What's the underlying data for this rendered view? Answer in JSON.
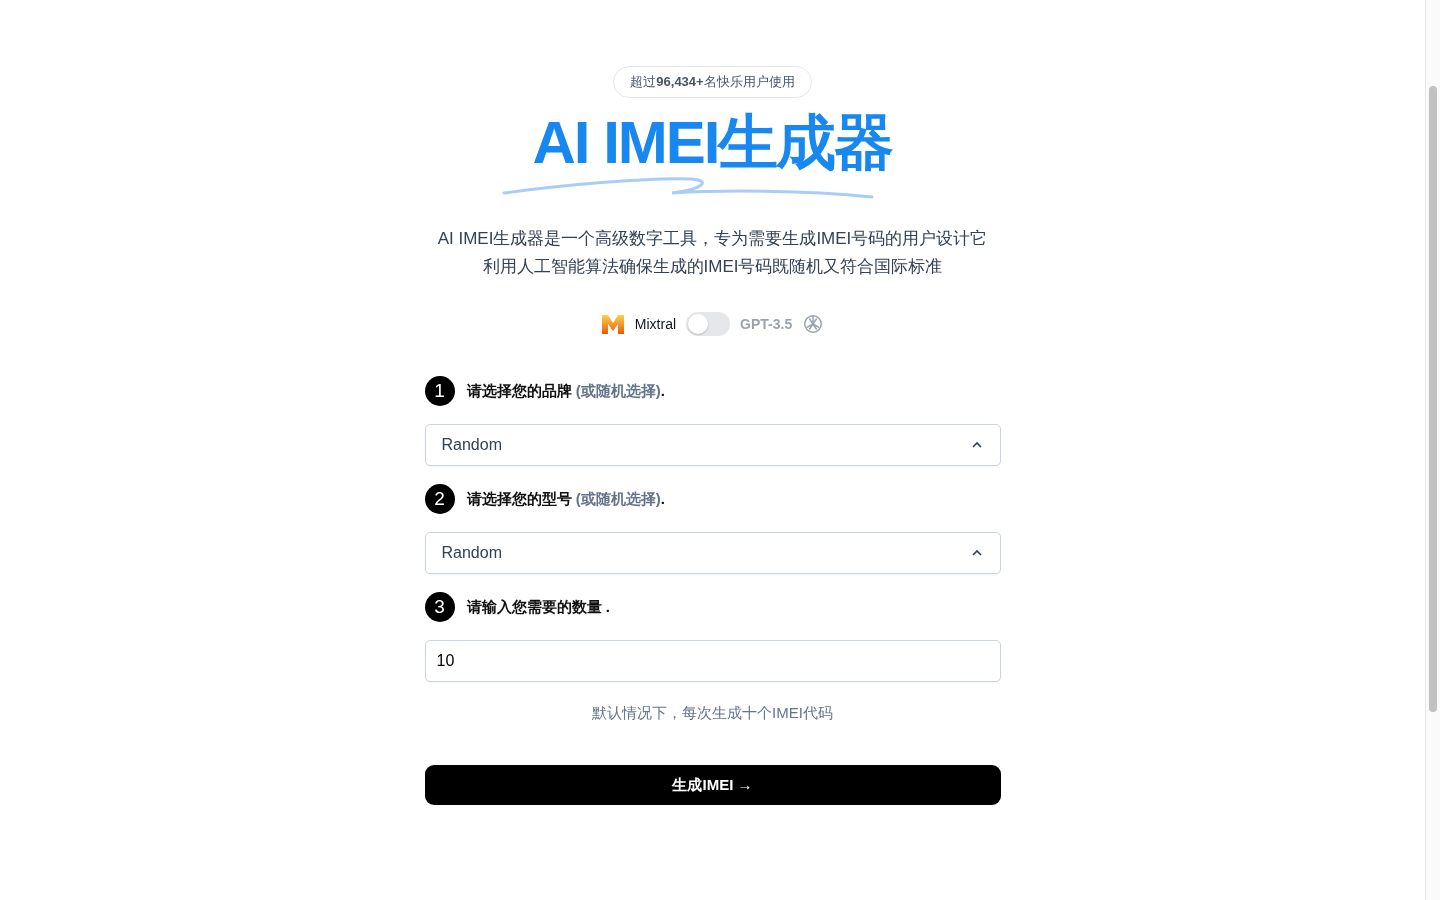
{
  "badge": "超过**96,434+**名快乐用户使用",
  "title": "AI IMEI生成器",
  "description": [
    "AI IMEI生成器是一个高级数字工具，专为需要生成IMEI号码的用户设计它",
    "利用人工智能算法确保生成的IMEI号码既随机又符合国际标准"
  ],
  "model_switch": {
    "left_label": "Mixtral",
    "right_label": "GPT-3.5",
    "on": false
  },
  "steps": [
    {
      "number": "1",
      "label": "请选择您的品牌",
      "hint": "(或随机选择)",
      "end": ".",
      "kind": "select",
      "value": "Random"
    },
    {
      "number": "2",
      "label": "请选择您的型号",
      "hint": "(或随机选择)",
      "end": ".",
      "kind": "select",
      "value": "Random"
    },
    {
      "number": "3",
      "label": "请输入您需要的数量",
      "end": " .",
      "kind": "input",
      "value": "10"
    }
  ],
  "note": "默认情况下，每次生成十个IMEI代码",
  "submit": "生成IMEI →"
}
